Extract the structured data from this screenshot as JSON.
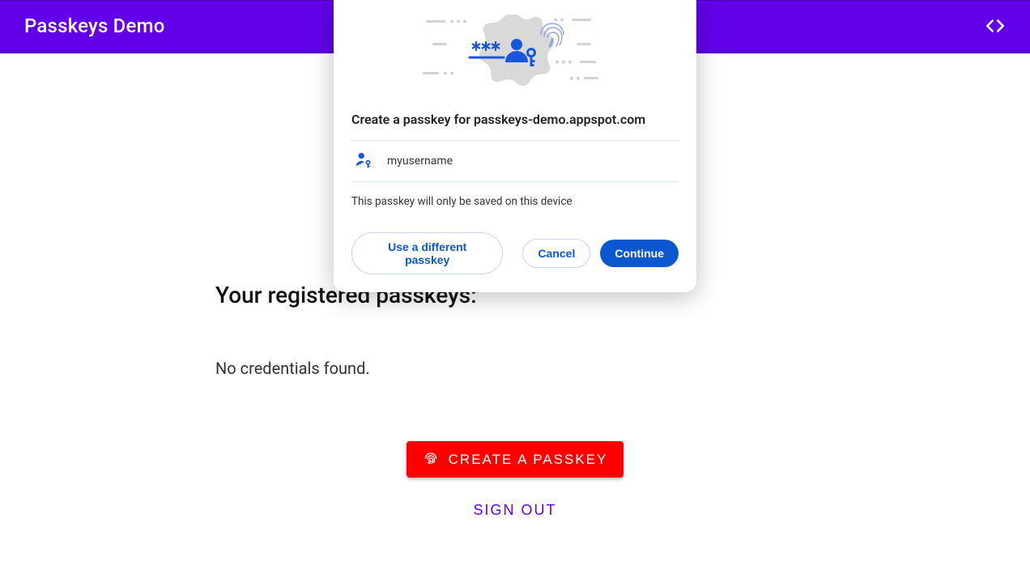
{
  "header": {
    "title": "Passkeys Demo"
  },
  "main": {
    "heading": "Your registered passkeys:",
    "empty_message": "No credentials found.",
    "create_label": "CREATE A PASSKEY",
    "signout_label": "SIGN OUT"
  },
  "dialog": {
    "title": "Create a passkey for passkeys-demo.appspot.com",
    "username": "myusername",
    "note": "This passkey will only be saved on this device",
    "use_different_label": "Use a different passkey",
    "cancel_label": "Cancel",
    "continue_label": "Continue"
  }
}
